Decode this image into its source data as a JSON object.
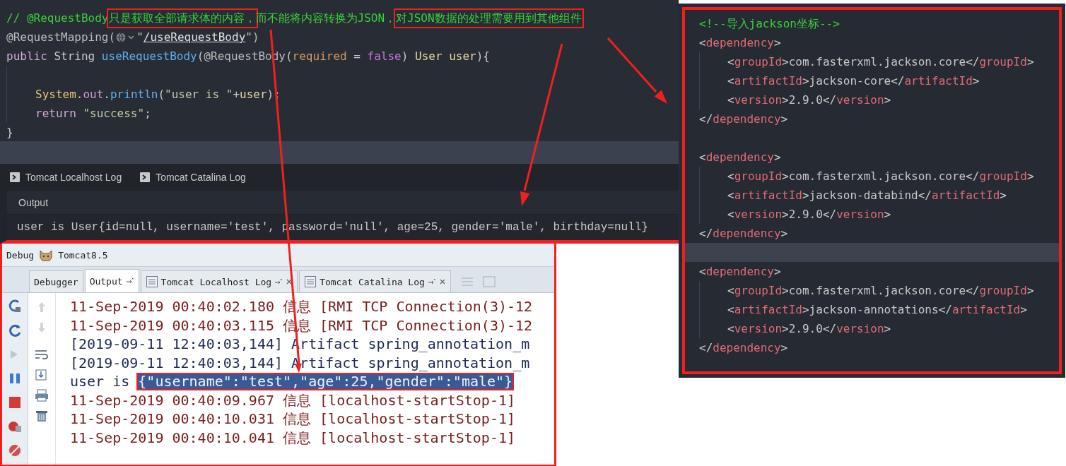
{
  "editor": {
    "lines": [
      {
        "kind": "code",
        "tokens": [
          {
            "kind": "comment",
            "text": "// @RequestBody",
            "boxed": false
          },
          {
            "kind": "comment",
            "text": "只是获取全部请求体的内容，",
            "boxed": true
          },
          {
            "kind": "comment",
            "text": "而不能将内容转换为JSON，",
            "boxed": false
          },
          {
            "kind": "comment",
            "text": "对JSON数据的处理需要用到其他组件",
            "boxed": true
          }
        ]
      },
      {
        "kind": "code",
        "tokens": [
          {
            "kind": "annotation",
            "text": "@RequestMapping("
          },
          {
            "kind": "inlay"
          },
          {
            "kind": "string",
            "text": "\""
          },
          {
            "kind": "link",
            "text": "/useRequestBody"
          },
          {
            "kind": "string",
            "text": "\""
          },
          {
            "kind": "annotation",
            "text": ")"
          }
        ]
      },
      {
        "kind": "code",
        "tokens": [
          {
            "kind": "keyword",
            "text": "public"
          },
          {
            "kind": "plain",
            "text": " String "
          },
          {
            "kind": "method",
            "text": "useRequestBody"
          },
          {
            "kind": "plain",
            "text": "("
          },
          {
            "kind": "annotation",
            "text": "@RequestBody"
          },
          {
            "kind": "plain",
            "text": "("
          },
          {
            "kind": "param",
            "text": "required"
          },
          {
            "kind": "plain",
            "text": " = "
          },
          {
            "kind": "literal",
            "text": "false"
          },
          {
            "kind": "plain",
            "text": ") "
          },
          {
            "kind": "variable",
            "text": "User user"
          },
          {
            "kind": "plain",
            "text": "){"
          }
        ],
        "children": [
          {
            "kind": "blank"
          },
          {
            "kind": "code",
            "tokens": [
              {
                "kind": "class",
                "text": "System"
              },
              {
                "kind": "plain",
                "text": "."
              },
              {
                "kind": "field",
                "text": "out"
              },
              {
                "kind": "plain",
                "text": "."
              },
              {
                "kind": "method",
                "text": "println"
              },
              {
                "kind": "plain",
                "text": "("
              },
              {
                "kind": "string",
                "text": "\"user is \""
              },
              {
                "kind": "plain",
                "text": "+"
              },
              {
                "kind": "variable",
                "text": "user"
              },
              {
                "kind": "plain",
                "text": ");"
              }
            ]
          },
          {
            "kind": "code",
            "tokens": [
              {
                "kind": "keyword",
                "text": "return "
              },
              {
                "kind": "string",
                "text": "\"success\""
              },
              {
                "kind": "plain",
                "text": ";"
              }
            ]
          }
        ]
      },
      {
        "kind": "code",
        "tokens": [
          {
            "kind": "plain",
            "text": "}"
          }
        ]
      }
    ]
  },
  "tool_window": {
    "tabs": [
      {
        "label": "Tomcat Localhost Log"
      },
      {
        "label": "Tomcat Catalina Log"
      }
    ],
    "output_title": "Output",
    "output_line": "user is User{id=null, username='test', password='null', age=25, gender='male', birthday=null}"
  },
  "debug_panel": {
    "title": "Debug",
    "config": "Tomcat8.5",
    "tabs": [
      {
        "label": "Debugger",
        "kind": "plain",
        "selected": false
      },
      {
        "label": "Output",
        "kind": "console",
        "selected": true
      },
      {
        "label": "Tomcat Localhost Log",
        "kind": "log",
        "selected": false
      },
      {
        "label": "Tomcat Catalina Log",
        "kind": "log",
        "selected": false
      }
    ],
    "lines": [
      {
        "kind": "stderr",
        "text": "11-Sep-2019 00:40:02.180 信息 [RMI TCP Connection(3)-12"
      },
      {
        "kind": "stderr",
        "text": "11-Sep-2019 00:40:03.115 信息 [RMI TCP Connection(3)-12"
      },
      {
        "kind": "stdout",
        "text": "[2019-09-11 12:40:03,144] Artifact spring_annotation_m"
      },
      {
        "kind": "stdout",
        "text": "[2019-09-11 12:40:03,144] Artifact spring_annotation_m"
      },
      {
        "kind": "stdout",
        "parts": [
          {
            "text": "user is ",
            "selected": false
          },
          {
            "text": "{\"username\":\"test\",\"age\":25,\"gender\":\"male\"}",
            "selected": true
          }
        ]
      },
      {
        "kind": "stderr",
        "text": "11-Sep-2019 00:40:09.967 信息 [localhost-startStop-1]"
      },
      {
        "kind": "stderr",
        "text": "11-Sep-2019 00:40:10.031 信息 [localhost-startStop-1]"
      },
      {
        "kind": "stderr",
        "text": "11-Sep-2019 00:40:10.041 信息 [localhost-startStop-1]"
      }
    ]
  },
  "xml": {
    "items": [
      {
        "kind": "comment",
        "text": "<!--导入jackson坐标-->"
      },
      {
        "kind": "element",
        "open": [
          {
            "kind": "punct",
            "text": "<"
          },
          {
            "kind": "tag",
            "text": "dependency"
          },
          {
            "kind": "punct",
            "text": ">"
          }
        ],
        "children": [
          [
            {
              "kind": "punct",
              "text": "<"
            },
            {
              "kind": "tag",
              "text": "groupId"
            },
            {
              "kind": "punct",
              "text": ">com.fasterxml.jackson.core</"
            },
            {
              "kind": "tag",
              "text": "groupId"
            },
            {
              "kind": "punct",
              "text": ">"
            }
          ],
          [
            {
              "kind": "punct",
              "text": "<"
            },
            {
              "kind": "tag",
              "text": "artifactId"
            },
            {
              "kind": "punct",
              "text": ">jackson-core</"
            },
            {
              "kind": "tag",
              "text": "artifactId"
            },
            {
              "kind": "punct",
              "text": ">"
            }
          ],
          [
            {
              "kind": "punct",
              "text": "<"
            },
            {
              "kind": "tag",
              "text": "version"
            },
            {
              "kind": "punct",
              "text": ">2.9.0</"
            },
            {
              "kind": "tag",
              "text": "version"
            },
            {
              "kind": "punct",
              "text": ">"
            }
          ]
        ],
        "close": [
          {
            "kind": "punct",
            "text": "</"
          },
          {
            "kind": "tag",
            "text": "dependency"
          },
          {
            "kind": "punct",
            "text": ">"
          }
        ]
      },
      {
        "kind": "blank",
        "current": false
      },
      {
        "kind": "element",
        "open": [
          {
            "kind": "punct",
            "text": "<"
          },
          {
            "kind": "tag",
            "text": "dependency"
          },
          {
            "kind": "punct",
            "text": ">"
          }
        ],
        "children": [
          [
            {
              "kind": "punct",
              "text": "<"
            },
            {
              "kind": "tag",
              "text": "groupId"
            },
            {
              "kind": "punct",
              "text": ">com.fasterxml.jackson.core</"
            },
            {
              "kind": "tag",
              "text": "groupId"
            },
            {
              "kind": "punct",
              "text": ">"
            }
          ],
          [
            {
              "kind": "punct",
              "text": "<"
            },
            {
              "kind": "tag",
              "text": "artifactId"
            },
            {
              "kind": "punct",
              "text": ">jackson-databind</"
            },
            {
              "kind": "tag",
              "text": "artifactId"
            },
            {
              "kind": "punct",
              "text": ">"
            }
          ],
          [
            {
              "kind": "punct",
              "text": "<"
            },
            {
              "kind": "tag",
              "text": "version"
            },
            {
              "kind": "punct",
              "text": ">2.9.0</"
            },
            {
              "kind": "tag",
              "text": "version"
            },
            {
              "kind": "punct",
              "text": ">"
            }
          ]
        ],
        "close": [
          {
            "kind": "punct",
            "text": "</"
          },
          {
            "kind": "tag",
            "text": "dependency"
          },
          {
            "kind": "punct",
            "text": ">"
          }
        ]
      },
      {
        "kind": "blank",
        "current": true
      },
      {
        "kind": "element",
        "open": [
          {
            "kind": "punct",
            "text": "<"
          },
          {
            "kind": "tag",
            "text": "dependency"
          },
          {
            "kind": "punct",
            "text": ">"
          }
        ],
        "children": [
          [
            {
              "kind": "punct",
              "text": "<"
            },
            {
              "kind": "tag",
              "text": "groupId"
            },
            {
              "kind": "punct",
              "text": ">com.fasterxml.jackson.core</"
            },
            {
              "kind": "tag",
              "text": "groupId"
            },
            {
              "kind": "punct",
              "text": ">"
            }
          ],
          [
            {
              "kind": "punct",
              "text": "<"
            },
            {
              "kind": "tag",
              "text": "artifactId"
            },
            {
              "kind": "punct",
              "text": ">jackson-annotations</"
            },
            {
              "kind": "tag",
              "text": "artifactId"
            },
            {
              "kind": "punct",
              "text": ">"
            }
          ],
          [
            {
              "kind": "punct",
              "text": "<"
            },
            {
              "kind": "tag",
              "text": "version"
            },
            {
              "kind": "punct",
              "text": ">2.9.0</"
            },
            {
              "kind": "tag",
              "text": "version"
            },
            {
              "kind": "punct",
              "text": ">"
            }
          ]
        ],
        "close": [
          {
            "kind": "punct",
            "text": "</"
          },
          {
            "kind": "tag",
            "text": "dependency"
          },
          {
            "kind": "punct",
            "text": ">"
          }
        ]
      }
    ]
  }
}
